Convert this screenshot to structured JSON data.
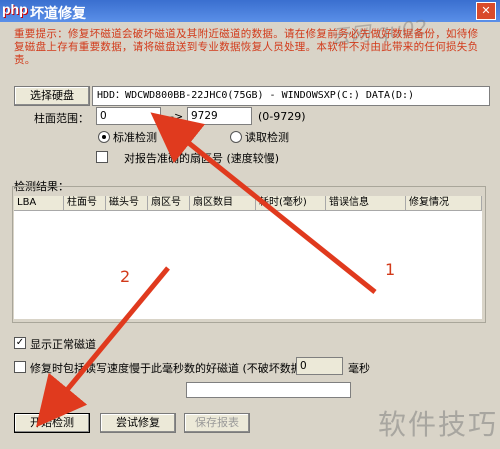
{
  "window": {
    "logo": "php",
    "title": "坏道修复",
    "close": "✕"
  },
  "watermark_top": "云网 qu02",
  "notice": "重要提示：修复坏磁道会破坏磁道及其附近磁道的数据。请在修复前务必先做好数据备份，如待修复磁盘上存有重要数据，请将磁盘送到专业数据恢复人员处理。本软件不对由此带来的任何损失负责。",
  "select_disk_button": "选择硬盘",
  "disk_info": "HDD：WDCWD800BB-22JHC0(75GB) - WINDOWSXP(C:) DATA(D:)",
  "range": {
    "label": "柱面范围：",
    "start": "0",
    "separator": "-->",
    "end": "9729",
    "hint": "(0-9729)"
  },
  "modes": {
    "standard": "标准检测",
    "read": "读取检测"
  },
  "accurate_option": "对报告准确的扇区号 (速度较慢)",
  "results_label": "检测结果：",
  "columns": [
    "LBA",
    "柱面号",
    "磁头号",
    "扇区号",
    "扇区数目",
    "耗时(毫秒)",
    "错误信息",
    "修复情况"
  ],
  "show_normal": "显示正常磁道",
  "repair_option": {
    "label": "修复时包括读写速度慢于此毫秒数的好磁道 (不破坏数据)：",
    "value": "0",
    "unit": "毫秒"
  },
  "buttons": {
    "start": "开始检测",
    "try_repair": "尝试修复",
    "save_report": "保存报表"
  },
  "annotations": {
    "one": "1",
    "two": "2"
  },
  "bottom_watermark": "软件技巧",
  "colors": {
    "notice": "#d23a1a",
    "arrow": "#e03a1e",
    "titlebar": "#3a6fcf"
  }
}
